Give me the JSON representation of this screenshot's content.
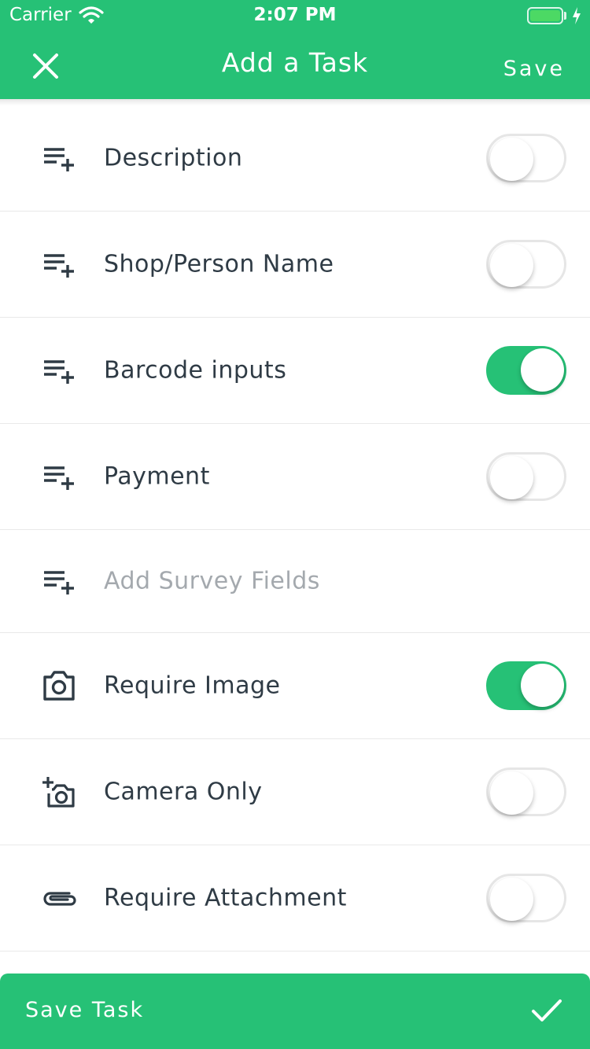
{
  "status_bar": {
    "carrier": "Carrier",
    "time": "2:07 PM"
  },
  "nav": {
    "title": "Add a Task",
    "save_label": "Save",
    "close_icon": "close-icon"
  },
  "rows": [
    {
      "icon": "playlist-add-icon",
      "label": "Description",
      "toggle": false
    },
    {
      "icon": "playlist-add-icon",
      "label": "Shop/Person Name",
      "toggle": false
    },
    {
      "icon": "playlist-add-icon",
      "label": "Barcode inputs",
      "toggle": true
    },
    {
      "icon": "playlist-add-icon",
      "label": "Payment",
      "toggle": false
    },
    {
      "icon": "playlist-add-icon",
      "label": "Add Survey Fields"
    },
    {
      "icon": "camera-icon",
      "label": "Require Image",
      "toggle": true
    },
    {
      "icon": "add-camera-icon",
      "label": "Camera Only",
      "toggle": false
    },
    {
      "icon": "paperclip-icon",
      "label": "Require Attachment",
      "toggle": false
    }
  ],
  "bottom_button": {
    "label": "Save Task",
    "icon": "check-icon"
  },
  "colors": {
    "accent": "#26c176",
    "text": "#2f3b45",
    "muted": "#a4a9ae",
    "divider": "#e9e9e9"
  }
}
